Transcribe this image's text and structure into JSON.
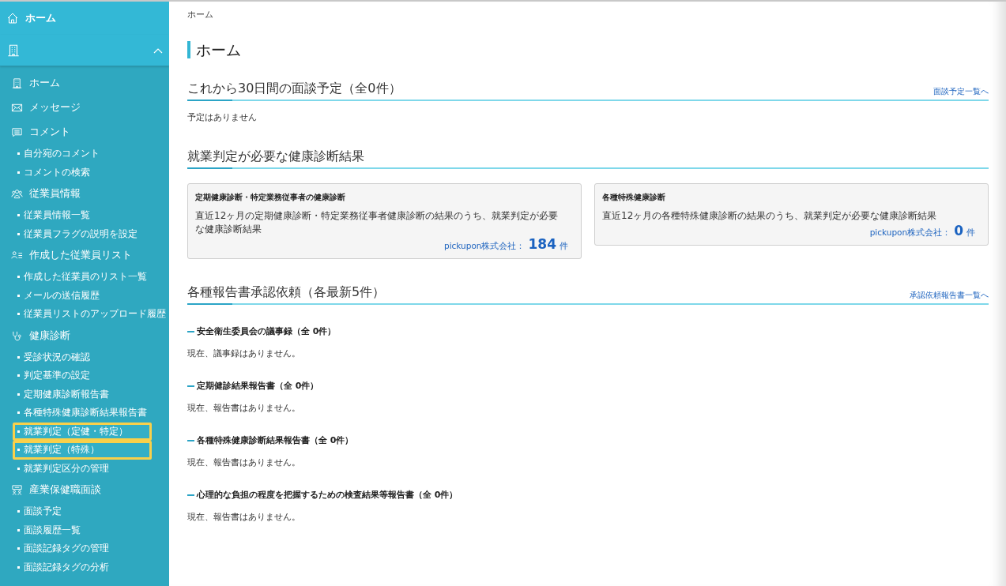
{
  "sidebar": {
    "top_item": {
      "label": "ホーム"
    },
    "org_header": {
      "expanded": true
    },
    "groups": [
      {
        "label": "ホーム"
      },
      {
        "label": "メッセージ"
      },
      {
        "label": "コメント",
        "children": [
          {
            "label": "自分宛のコメント",
            "highlighted": false
          },
          {
            "label": "コメントの検索",
            "highlighted": false
          }
        ]
      },
      {
        "label": "従業員情報",
        "children": [
          {
            "label": "従業員情報一覧",
            "highlighted": false
          },
          {
            "label": "従業員フラグの説明を設定",
            "highlighted": false
          }
        ]
      },
      {
        "label": "作成した従業員リスト",
        "children": [
          {
            "label": "作成した従業員のリスト一覧",
            "highlighted": false
          },
          {
            "label": "メールの送信履歴",
            "highlighted": false
          },
          {
            "label": "従業員リストのアップロード履歴",
            "highlighted": false
          }
        ]
      },
      {
        "label": "健康診断",
        "children": [
          {
            "label": "受診状況の確認",
            "highlighted": false
          },
          {
            "label": "判定基準の設定",
            "highlighted": false
          },
          {
            "label": "定期健康診断報告書",
            "highlighted": false
          },
          {
            "label": "各種特殊健康診断結果報告書",
            "highlighted": false
          },
          {
            "label": "就業判定（定健・特定）",
            "highlighted": true
          },
          {
            "label": "就業判定（特殊）",
            "highlighted": true
          },
          {
            "label": "就業判定区分の管理",
            "highlighted": false
          }
        ]
      },
      {
        "label": "産業保健職面談",
        "children": [
          {
            "label": "面談予定",
            "highlighted": false
          },
          {
            "label": "面談履歴一覧",
            "highlighted": false
          },
          {
            "label": "面談記録タグの管理",
            "highlighted": false
          },
          {
            "label": "面談記録タグの分析",
            "highlighted": false
          }
        ]
      }
    ]
  },
  "breadcrumb": "ホーム",
  "page_title": "ホーム",
  "interviews": {
    "title": "これから30日間の面談予定（全0件）",
    "link": "面談予定一覧へ",
    "empty": "予定はありません"
  },
  "health_results": {
    "title": "就業判定が必要な健康診断結果",
    "cards": [
      {
        "title": "定期健康診断・特定業務従事者の健康診断",
        "description": "直近12ヶ月の定期健康診断・特定業務従事者健康診断の結果のうち、就業判定が必要な健康診断結果",
        "company": "pickupon株式会社：",
        "count": "184",
        "unit": "件"
      },
      {
        "title": "各種特殊健康診断",
        "description": "直近12ヶ月の各種特殊健康診断の結果のうち、就業判定が必要な健康診断結果",
        "company": "pickupon株式会社：",
        "count": "0",
        "unit": "件"
      }
    ]
  },
  "approvals": {
    "title": "各種報告書承認依頼（各最新5件）",
    "link": "承認依頼報告書一覧へ",
    "sections": [
      {
        "title": "安全衛生委員会の議事録（全 0件）",
        "empty": "現在、議事録はありません。"
      },
      {
        "title": "定期健診結果報告書（全 0件）",
        "empty": "現在、報告書はありません。"
      },
      {
        "title": "各種特殊健康診断結果報告書（全 0件）",
        "empty": "現在、報告書はありません。"
      },
      {
        "title": "心理的な負担の程度を把握するための検査結果等報告書（全 0件）",
        "empty": "現在、報告書はありません。"
      }
    ]
  }
}
